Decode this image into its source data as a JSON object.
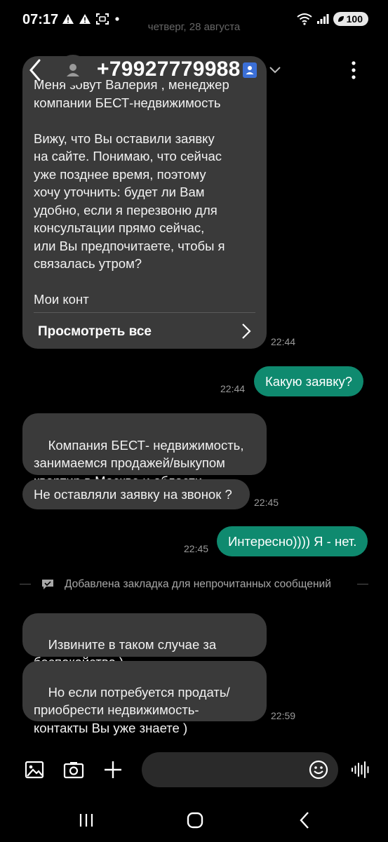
{
  "status_bar": {
    "time": "07:17",
    "battery": "100",
    "icons_left": [
      "warning-icon",
      "warning-icon",
      "screenshot-icon",
      "dot-icon"
    ],
    "icons_right": [
      "wifi-icon",
      "signal-icon",
      "battery-icon"
    ]
  },
  "date_separator": "четверг, 28 августа",
  "header": {
    "contact_name": "+79927779988",
    "icons": [
      "back-icon",
      "avatar-icon",
      "contact-card-icon",
      "chevron-down-icon",
      "more-vertical-icon"
    ]
  },
  "messages": {
    "m1": {
      "text": "Меня зовут Валерия , менеджер\nкомпании БЕСТ-недвижимость\n\nВижу, что Вы оставили заявку\nна сайте. Понимаю, что сейчас\nуже позднее время, поэтому\nхочу уточнить: будет ли Вам\nудобно, если я перезвоню для\nконсультации прямо сейчас,\nили Вы предпочитаете, чтобы я\nсвязалась утром?\n\nМои конт",
      "view_all": "Просмотреть все",
      "time": "22:44"
    },
    "m2": {
      "text": "Какую заявку?",
      "time": "22:44"
    },
    "m3": {
      "text": "Компания БЕСТ- недвижимость,\nзанимаемся продажей/выкупом\nквартир в Москве и области"
    },
    "m4": {
      "text": "Не оставляли заявку на звонок ?",
      "time": "22:45"
    },
    "m5": {
      "text": "Интересно)))) Я - нет.",
      "time": "22:45"
    },
    "bookmark": "Добавлена закладка для непрочитанных сообщений",
    "m6": {
      "text": "Извините в таком случае за\nбеспокойство )"
    },
    "m7": {
      "text": "Но если потребуется продать/\nприобрести недвижимость-\nконтакты Вы уже знаете )",
      "time": "22:59"
    }
  },
  "input_bar": {
    "placeholder": "",
    "icons": [
      "gallery-icon",
      "camera-icon",
      "plus-icon",
      "emoji-icon",
      "voice-icon"
    ]
  },
  "nav_bar": {
    "icons": [
      "recents-icon",
      "home-icon",
      "back-nav-icon"
    ]
  },
  "colors": {
    "background": "#000000",
    "incoming_bubble": "#3a3a3a",
    "outgoing_bubble": "#0f8a6f",
    "timestamp": "#9a9a9a",
    "contact_badge": "#3b6fd6"
  }
}
